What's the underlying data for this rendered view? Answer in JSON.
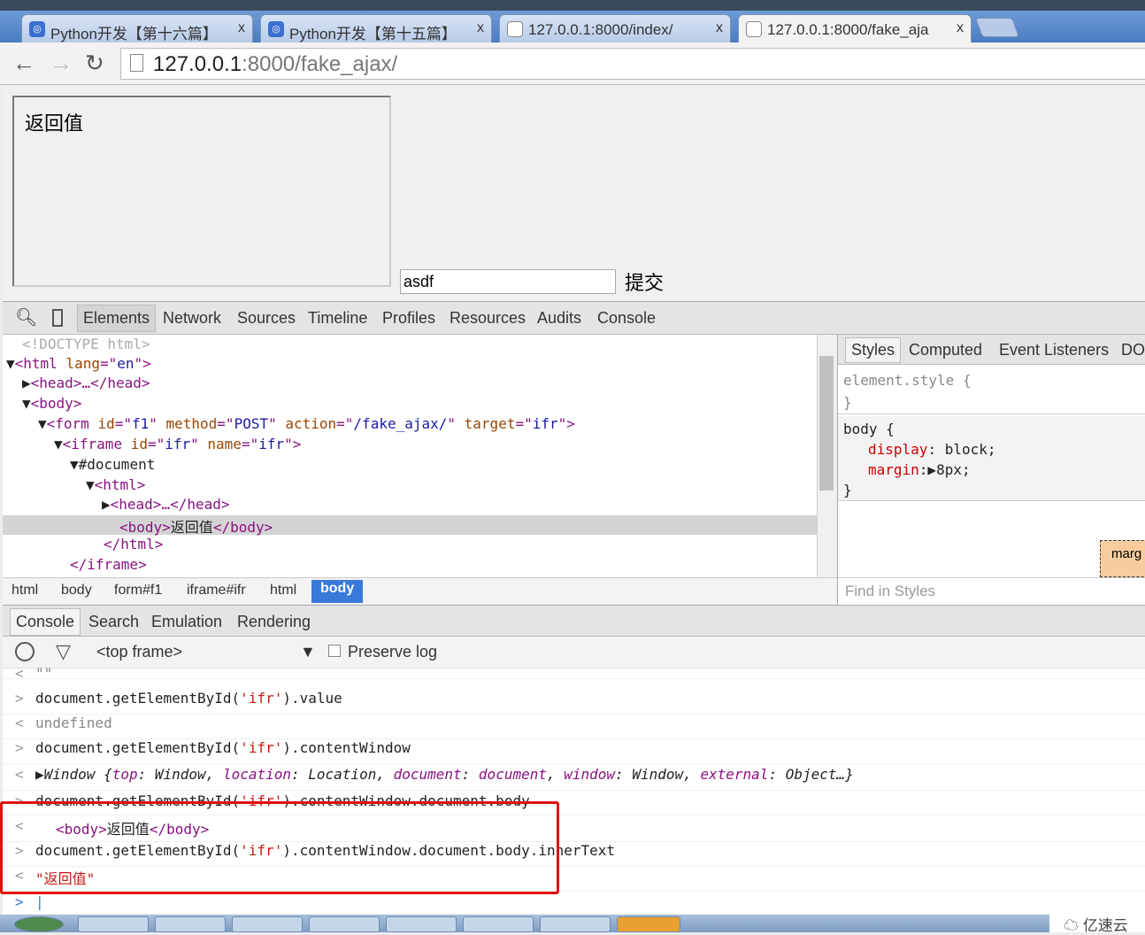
{
  "browser": {
    "tabs": [
      {
        "title": "Python开发【第十六篇】",
        "icon": "app-icon"
      },
      {
        "title": "Python开发【第十五篇】",
        "icon": "app-icon"
      },
      {
        "title": "127.0.0.1:8000/index/",
        "icon": "page-icon"
      },
      {
        "title": "127.0.0.1:8000/fake_aja",
        "icon": "page-icon",
        "active": true
      }
    ],
    "close_glyph": "x",
    "url_host": "127.0.0.1",
    "url_rest": ":8000/fake_ajax/"
  },
  "page": {
    "iframe_text": "返回值",
    "input_value": "asdf",
    "submit_label": "提交"
  },
  "devtools": {
    "tabs": [
      "Elements",
      "Network",
      "Sources",
      "Timeline",
      "Profiles",
      "Resources",
      "Audits",
      "Console"
    ],
    "dom": {
      "doctype": "<!DOCTYPE html>",
      "html_lang": "en",
      "form_id": "f1",
      "form_method": "POST",
      "form_action": "/fake_ajax/",
      "form_target": "ifr",
      "iframe_id": "ifr",
      "iframe_name": "ifr",
      "document": "#document",
      "body_text": "返回值"
    },
    "breadcrumbs": [
      "html",
      "body",
      "form#f1",
      "iframe#ifr",
      "html",
      "body"
    ],
    "styles": {
      "tabs": [
        "Styles",
        "Computed",
        "Event Listeners",
        "DO"
      ],
      "element_style": "element.style {",
      "close": "}",
      "body_rule": "body {",
      "display_prop": "display",
      "display_val": "block;",
      "margin_prop": "margin",
      "margin_val": "8px;",
      "box_label": "marg",
      "find_placeholder": "Find in Styles"
    },
    "drawer_tabs": [
      "Console",
      "Search",
      "Emulation",
      "Rendering"
    ],
    "console_toolbar": {
      "frame": "<top frame>",
      "preserve_log": "Preserve log",
      "preserve_checked": false
    },
    "console": {
      "l0": "\"\"",
      "l1a": "document.getElementById(",
      "l1s": "'ifr'",
      "l1b": ").value",
      "l2": "undefined",
      "l3b": ").contentWindow",
      "l4": {
        "pre": "Window {",
        "top": "top",
        "topv": "Window",
        "loc": "location",
        "locv": "Location",
        "doc": "document",
        "docv": "document",
        "win": "window",
        "winv": "Window",
        "ext": "external",
        "extv": "Object…}"
      },
      "l5b": ").contentWindow.document.body",
      "l6": "返回值",
      "l7b": ").contentWindow.document.body.innerText",
      "l8": "\"返回值\""
    }
  },
  "watermark": "亿速云",
  "colors": {
    "highlight": "#e01010",
    "selected_crumb": "#3879d9"
  }
}
